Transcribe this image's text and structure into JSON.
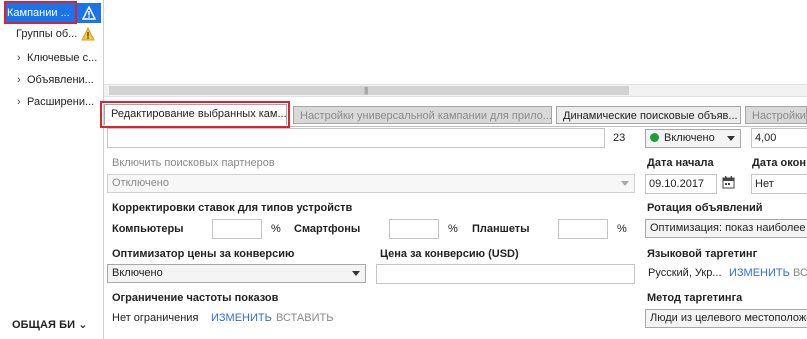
{
  "tree": {
    "items": [
      {
        "label": "Кампании ..."
      },
      {
        "label": "Группы об..."
      },
      {
        "label": "Ключевые с..."
      },
      {
        "label": "Объявлени..."
      },
      {
        "label": "Расширени..."
      }
    ],
    "bottom_menu": "ОБЩАЯ БИ"
  },
  "tabs": [
    {
      "label": "Редактирование выбранных кам..."
    },
    {
      "label": "Настройки универсальной кампании для прило..."
    },
    {
      "label": "Динамические поисковые объяв..."
    },
    {
      "label": "Настройки"
    }
  ],
  "form": {
    "name_count": "23",
    "status": "Включено",
    "bid_value": "4,00",
    "search_partners_label": "Включить поисковых партнеров",
    "search_partners_value": "Отключено",
    "start_date_label": "Дата начала",
    "start_date_value": "09.10.2017",
    "end_date_label": "Дата окон",
    "end_date_value": "Нет",
    "device_bid_title": "Корректировки ставок для типов устройств",
    "computers_label": "Компьютеры",
    "smartphones_label": "Смартфоны",
    "tablets_label": "Планшеты",
    "percent": "%",
    "ad_rotation_label": "Ротация объявлений",
    "ad_rotation_value": "Оптимизация: показ наиболее эф",
    "cpa_optimizer_label": "Оптимизатор цены за конверсию",
    "cpa_optimizer_value": "Включено",
    "cpa_price_label": "Цена за конверсию (USD)",
    "language_label": "Языковой таргетинг",
    "language_value": "Русский, Укр...",
    "change": "ИЗМЕНИТЬ",
    "insert": "ВСТАВИТЬ",
    "language_trailing": "ВС",
    "freq_cap_label": "Ограничение частоты показов",
    "freq_cap_value": "Нет ограничения",
    "targeting_method_label": "Метод таргетинга",
    "targeting_method_value": "Люди из целевого местоположе"
  }
}
